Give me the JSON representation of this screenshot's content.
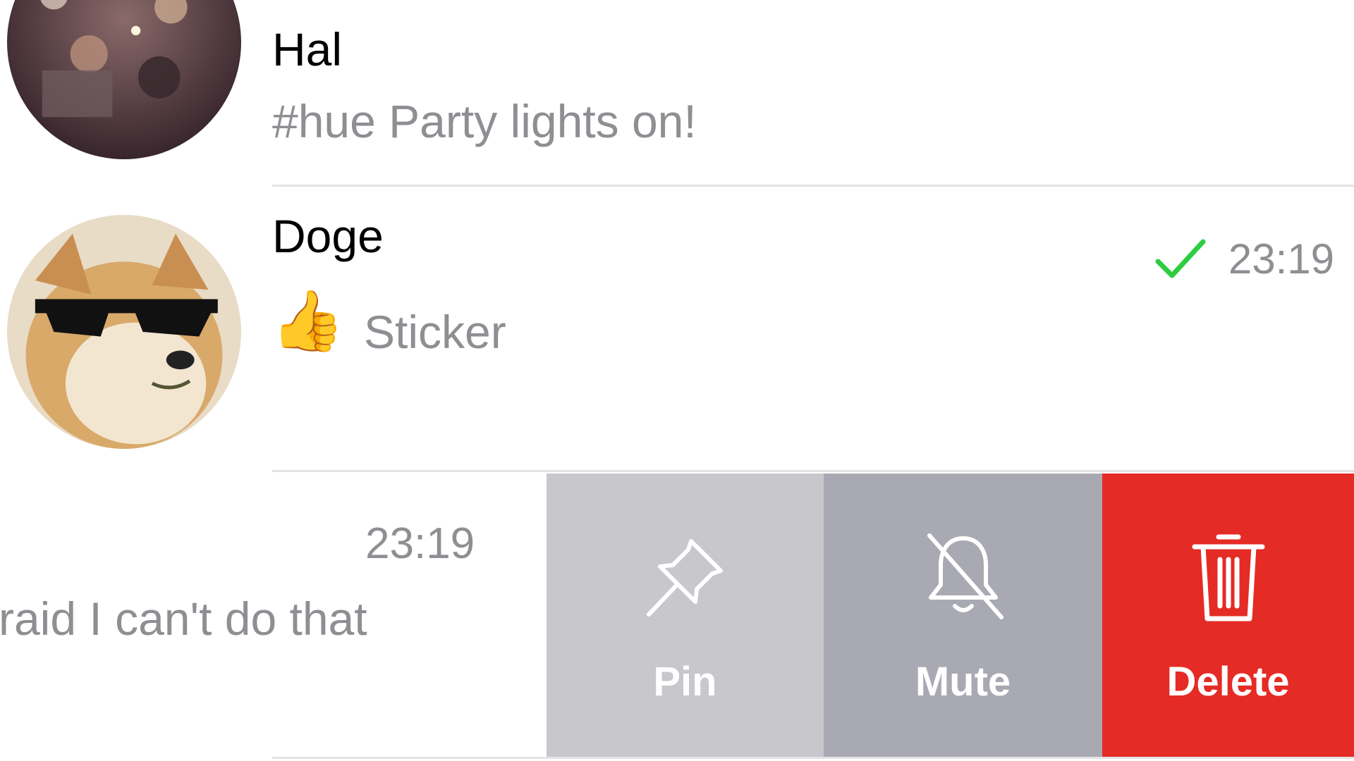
{
  "chats": [
    {
      "name": "Hal",
      "preview": "#hue Party lights on!",
      "avatar_icon": "crowd-photo-avatar"
    },
    {
      "name": "Doge",
      "preview_emoji": "👍",
      "preview": "Sticker",
      "time": "23:19",
      "status_icon": "checkmark-icon",
      "avatar_icon": "doge-sunglasses-avatar"
    },
    {
      "time": "23:19",
      "preview": "raid I can't do that"
    }
  ],
  "swipe_actions": [
    {
      "label": "Pin",
      "icon": "pin-icon",
      "color": "#c7c7cc"
    },
    {
      "label": "Mute",
      "icon": "bell-slash-icon",
      "color": "#a9a9b3"
    },
    {
      "label": "Delete",
      "icon": "trash-icon",
      "color": "#e52b25"
    }
  ],
  "colors": {
    "check": "#2ecc40",
    "secondary_text": "#8e8e93"
  }
}
